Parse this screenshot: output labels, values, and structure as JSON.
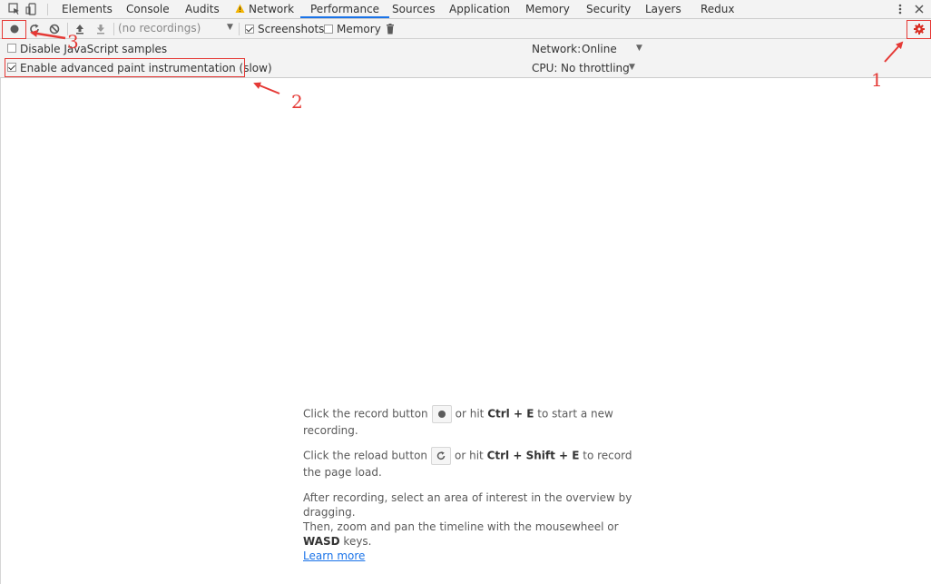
{
  "tabs": [
    {
      "label": "Elements",
      "active": false
    },
    {
      "label": "Console",
      "active": false
    },
    {
      "label": "Audits",
      "active": false
    },
    {
      "label": "Network",
      "active": false,
      "warning": true
    },
    {
      "label": "Performance",
      "active": true
    },
    {
      "label": "Sources",
      "active": false
    },
    {
      "label": "Application",
      "active": false
    },
    {
      "label": "Memory",
      "active": false
    },
    {
      "label": "Security",
      "active": false
    },
    {
      "label": "Layers",
      "active": false
    },
    {
      "label": "Redux",
      "active": false
    }
  ],
  "toolbar": {
    "recordings_select": "(no recordings)",
    "screenshots_label": "Screenshots",
    "screenshots_checked": true,
    "memory_label": "Memory",
    "memory_checked": false
  },
  "settings": {
    "disable_js_samples_label": "Disable JavaScript samples",
    "disable_js_samples_checked": false,
    "advanced_paint_label": "Enable advanced paint instrumentation (slow)",
    "advanced_paint_checked": true,
    "network_label": "Network:",
    "network_value": "Online",
    "cpu_label": "CPU:",
    "cpu_value": "No throttling"
  },
  "annotations": {
    "n1": "1",
    "n2": "2",
    "n3": "3",
    "color": "#e53935"
  },
  "landing": {
    "record_pre": "Click the record button",
    "record_mid": "or hit",
    "record_key": "Ctrl + E",
    "record_post": "to start a new recording.",
    "reload_pre": "Click the reload button",
    "reload_mid": "or hit",
    "reload_key": "Ctrl + Shift + E",
    "reload_post": "to record the page load.",
    "after_text": "After recording, select an area of interest in the overview by dragging.",
    "zoom_pre": "Then, zoom and pan the timeline with the mousewheel or",
    "zoom_key": "WASD",
    "zoom_post": "keys.",
    "learn_more": "Learn more"
  },
  "colors": {
    "accent": "#1a73e8",
    "panel_bg": "#f3f3f3",
    "annotation_red": "#e53935"
  }
}
